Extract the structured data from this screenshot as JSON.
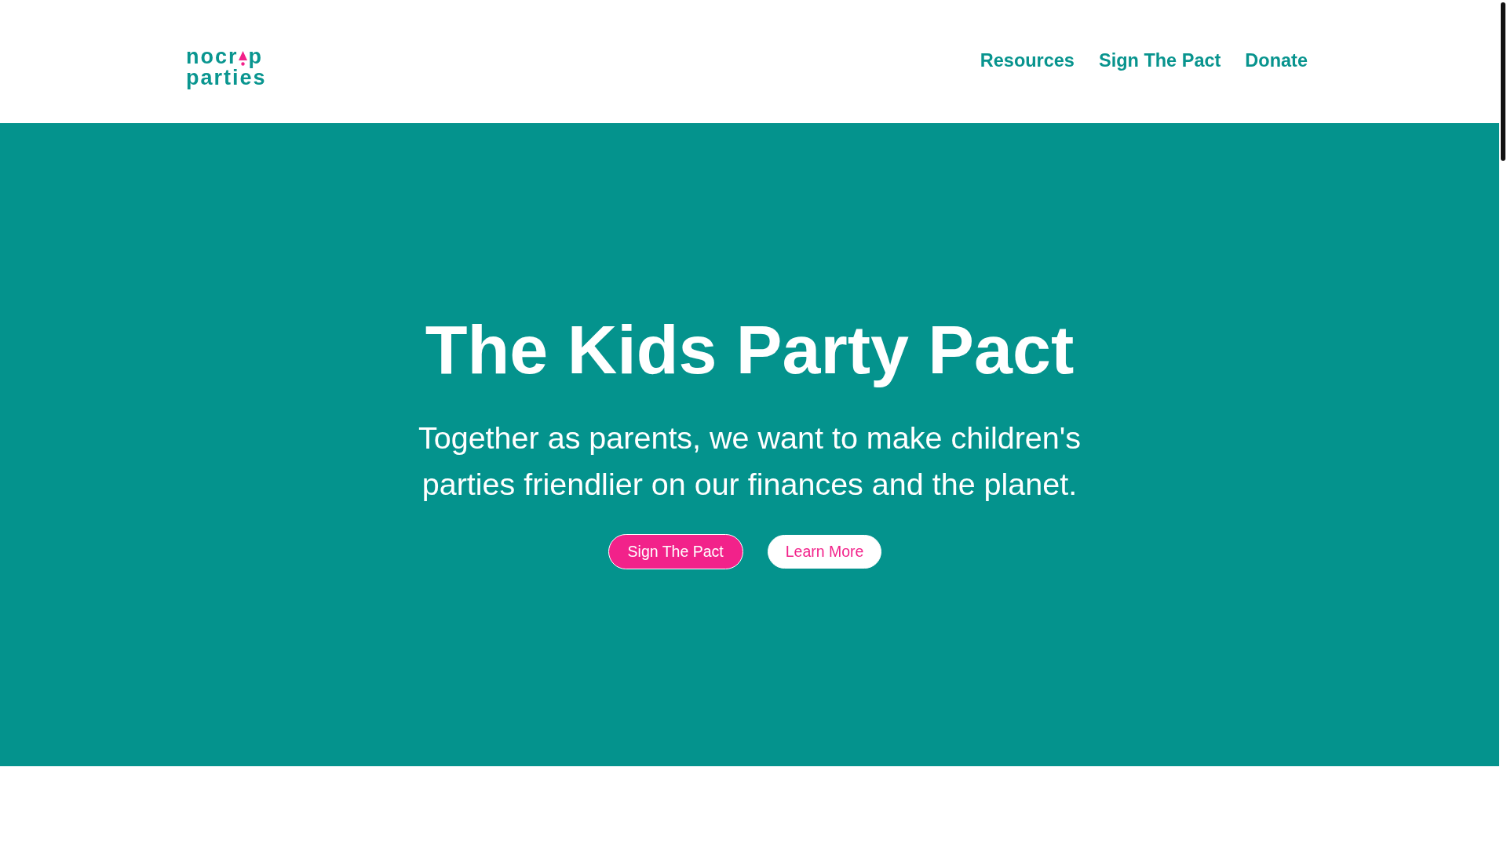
{
  "header": {
    "logo": {
      "line_1_start": "nocr",
      "line_1_end": "p",
      "line_2": "parties"
    },
    "nav": [
      "Resources",
      "Sign The Pact",
      "Donate"
    ]
  },
  "hero": {
    "title": "The Kids Party Pact",
    "subtitle": "Together as parents, we want to make children's parties friendlier on our finances and the planet.",
    "buttons": [
      {
        "label": "Sign The Pact",
        "kind": "primary"
      },
      {
        "label": "Learn More",
        "kind": "secondary"
      }
    ]
  }
}
